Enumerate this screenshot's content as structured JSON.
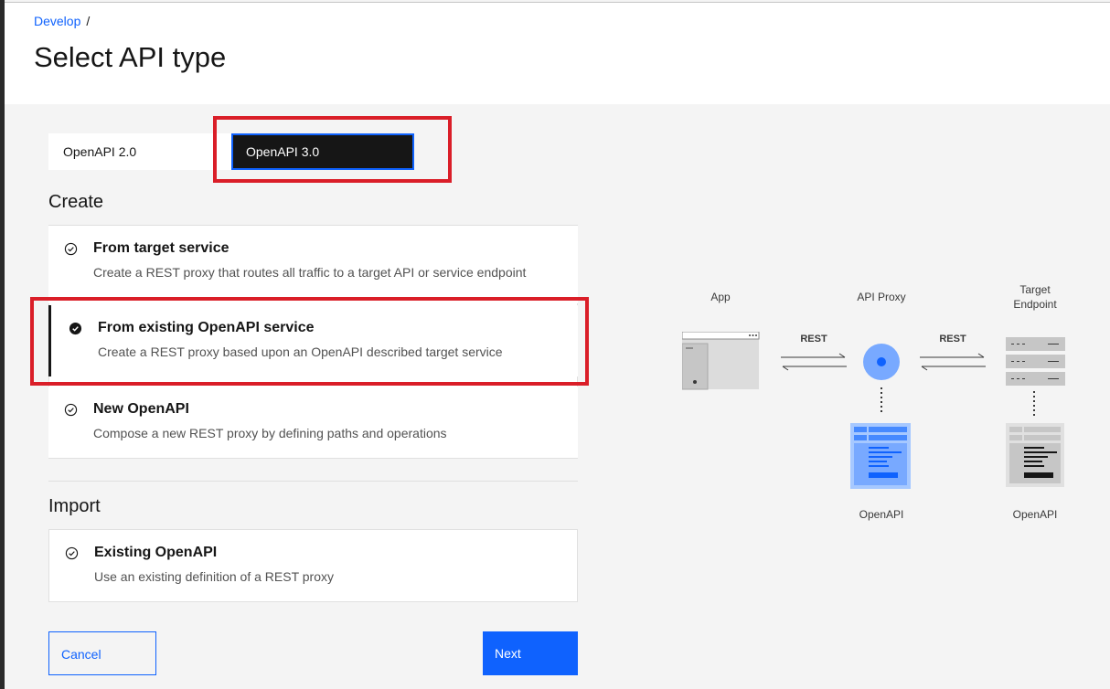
{
  "breadcrumb": {
    "parent": "Develop",
    "separator": "/"
  },
  "page_title": "Select API type",
  "version_toggle": {
    "options": [
      "OpenAPI 2.0",
      "OpenAPI 3.0"
    ],
    "selected": "OpenAPI 3.0"
  },
  "create": {
    "heading": "Create",
    "tiles": [
      {
        "title": "From target service",
        "description": "Create a REST proxy that routes all traffic to a target API or service endpoint",
        "selected": false
      },
      {
        "title": "From existing OpenAPI service",
        "description": "Create a REST proxy based upon an OpenAPI described target service",
        "selected": true
      },
      {
        "title": "New OpenAPI",
        "description": "Compose a new REST proxy by defining paths and operations",
        "selected": false
      }
    ]
  },
  "import": {
    "heading": "Import",
    "tiles": [
      {
        "title": "Existing OpenAPI",
        "description": "Use an existing definition of a REST proxy",
        "selected": false
      }
    ]
  },
  "diagram": {
    "app_label": "App",
    "proxy_label": "API Proxy",
    "target_label_line1": "Target",
    "target_label_line2": "Endpoint",
    "rest_left": "REST",
    "rest_right": "REST",
    "openapi_left": "OpenAPI",
    "openapi_right": "OpenAPI"
  },
  "buttons": {
    "cancel": "Cancel",
    "next": "Next"
  },
  "colors": {
    "accent": "#0f62fe",
    "annotation": "#da1e28",
    "selected": "#161616"
  }
}
